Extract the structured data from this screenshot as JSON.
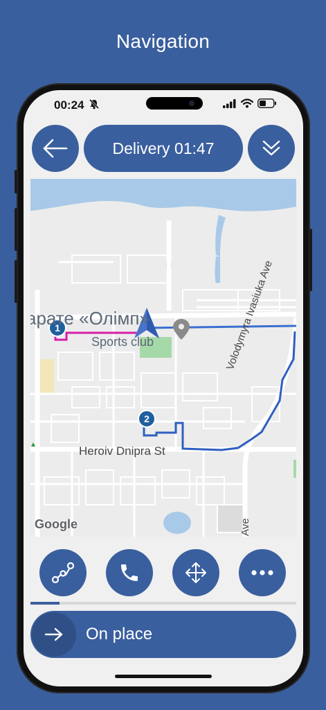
{
  "header": {
    "title": "Navigation"
  },
  "status_bar": {
    "time": "00:24"
  },
  "top_bar": {
    "delivery_label": "Delivery 01:47"
  },
  "map": {
    "place_name": "арате «Олімп»",
    "place_category": "Sports club",
    "street_1": "Heroiv Dnipra St",
    "street_2": "Volodymyra Ivasiuka Ave",
    "street_3": "Ave",
    "attribution": "Google",
    "stop_1": "1",
    "stop_2": "2",
    "route_colors": {
      "to_stop_1": "#d61ea8",
      "to_stop_2": "#3a6fd0"
    }
  },
  "toolbar": {
    "buttons": [
      {
        "icon": "route-icon"
      },
      {
        "icon": "phone-icon"
      },
      {
        "icon": "move-icon"
      },
      {
        "icon": "more-icon"
      }
    ]
  },
  "progress": {
    "fraction": 0.11
  },
  "action": {
    "label": "On place"
  },
  "colors": {
    "accent": "#3a5f9e"
  }
}
